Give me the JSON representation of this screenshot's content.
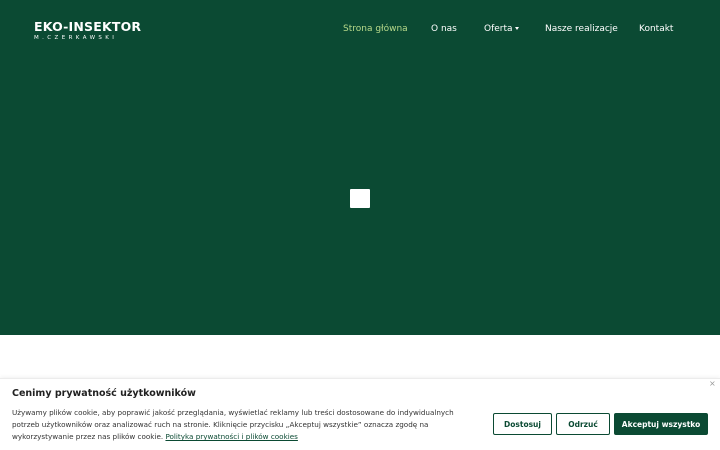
{
  "brand": {
    "name": "EKO-INSEKTOR",
    "subtitle": "M.CZERKAWSKI"
  },
  "nav": {
    "items": [
      {
        "label": "Strona główna",
        "active": true
      },
      {
        "label": "O nas",
        "active": false
      },
      {
        "label": "Oferta",
        "active": false,
        "has_dropdown": true
      },
      {
        "label": "Nasze realizacje",
        "active": false
      },
      {
        "label": "Kontakt",
        "active": false
      }
    ]
  },
  "cookie_banner": {
    "title": "Cenimy prywatność użytkowników",
    "text": "Używamy plików cookie, aby poprawić jakość przeglądania, wyświetlać reklamy lub treści dostosowane do indywidualnych potrzeb użytkowników oraz analizować ruch na stronie. Kliknięcie przycisku „Akceptuj wszystkie” oznacza zgodę na wykorzystywanie przez nas plików cookie.",
    "link_label": "Polityka prywatności i plików cookies",
    "close_label": "×",
    "buttons": {
      "customize": "Dostosuj",
      "reject": "Odrzuć",
      "accept_all": "Akceptuj wszystko"
    }
  },
  "colors": {
    "brand_green": "#0b4a33",
    "active_nav": "#b7d98a",
    "white": "#ffffff"
  },
  "icons": {
    "loader": "loading-square-icon",
    "close": "close-icon",
    "dropdown": "caret-down-icon"
  }
}
